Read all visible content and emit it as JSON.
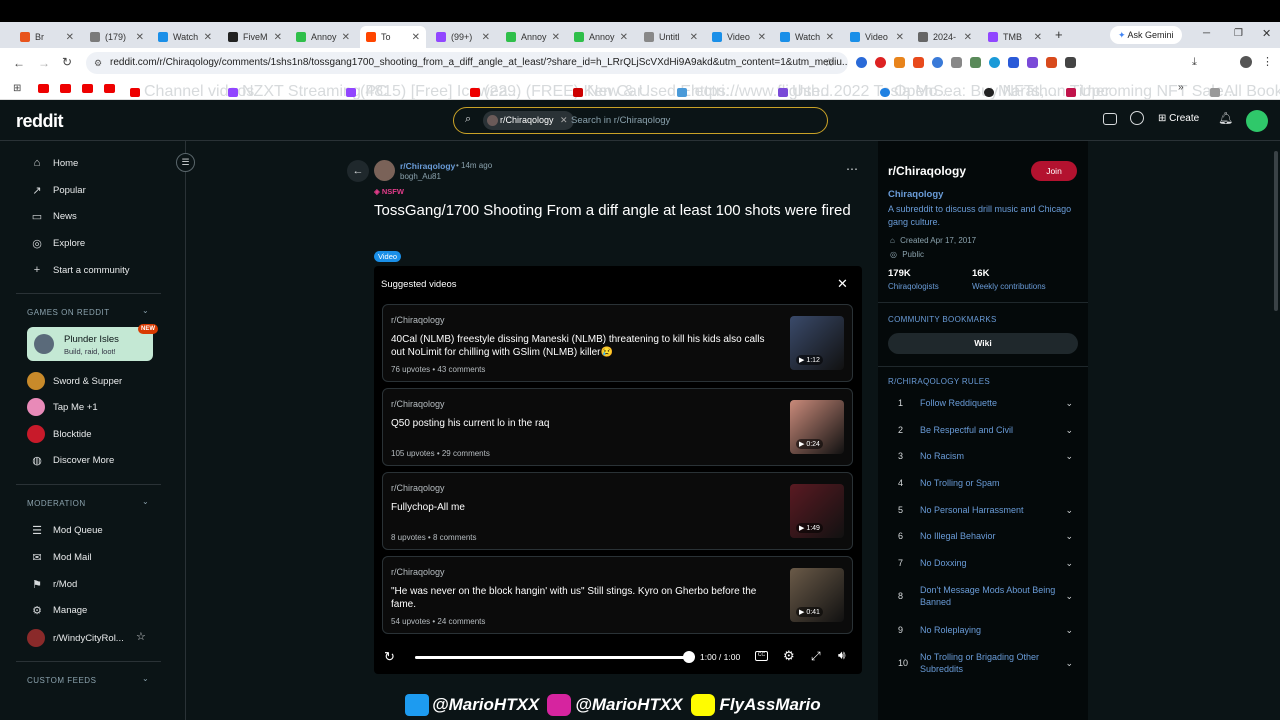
{
  "browser": {
    "tabs": [
      {
        "label": "Br",
        "color": "#e8541c"
      },
      {
        "label": "(179)",
        "color": "#7a7a7a"
      },
      {
        "label": "Watch",
        "color": "#1a8fe8"
      },
      {
        "label": "FiveM",
        "color": "#222222"
      },
      {
        "label": "Annoy",
        "color": "#2fbf4a"
      },
      {
        "label": "To",
        "color": "#ff4500"
      },
      {
        "label": "(99+)",
        "color": "#9146ff"
      },
      {
        "label": "Annoy",
        "color": "#2fbf4a"
      },
      {
        "label": "Annoy",
        "color": "#2fbf4a"
      },
      {
        "label": "Untitl",
        "color": "#888888"
      },
      {
        "label": "Video",
        "color": "#1a8fe8"
      },
      {
        "label": "Watch",
        "color": "#1a8fe8"
      },
      {
        "label": "Video",
        "color": "#1a8fe8"
      },
      {
        "label": "2024-",
        "color": "#666666"
      },
      {
        "label": "TMB",
        "color": "#9146ff"
      }
    ],
    "ask_gemini": "Ask Gemini",
    "url": "reddit.com/r/Chiraqology/comments/1shs1n8/tossgang1700_shooting_from_a_diff_angle_at_least/?share_id=h_LRrQLjScVXdHi9A9akd&utm_content=1&utm_mediu...",
    "bookmarks": [
      "Channel videos",
      "NZXT Streaming PC",
      "(4815) [Free] Icewea...",
      "(229) (FREE) Ken Car...",
      "New & Used Electri...",
      "https://www.flighth...",
      "Used 2022 Tesla Mo...",
      "OpenSea: Buy NFTs,...",
      "Marathon Timer",
      "Upcoming NFT Sale..."
    ],
    "all_bookmarks": "All Bookmarks"
  },
  "header": {
    "logo": "reddit",
    "search_chip": "r/Chiraqology",
    "search_placeholder": "Search in r/Chiraqology",
    "create": "Create"
  },
  "sidebar": {
    "nav": [
      "Home",
      "Popular",
      "News",
      "Explore",
      "Start a community"
    ],
    "games_title": "GAMES ON REDDIT",
    "featured_game": {
      "name": "Plunder Isles",
      "tagline": "Build, raid, loot!",
      "badge": "NEW"
    },
    "games": [
      "Sword & Supper",
      "Tap Me +1",
      "Blocktide",
      "Discover More"
    ],
    "moderation_title": "MODERATION",
    "moderation": [
      "Mod Queue",
      "Mod Mail",
      "r/Mod",
      "Manage",
      "r/WindyCityRol..."
    ],
    "custom_feeds_title": "CUSTOM FEEDS"
  },
  "post": {
    "subreddit": "r/Chiraqology",
    "time": "• 14m ago",
    "author": "bogh_Au81",
    "nsfw": "NSFW",
    "title": "TossGang/1700 Shooting From a diff angle at least 100 shots were fired",
    "flair": "Video"
  },
  "player": {
    "suggested_title": "Suggested videos",
    "time": "1:00 / 1:00",
    "progress": 1.0,
    "suggestions": [
      {
        "sub": "r/Chiraqology",
        "title": "40Cal (NLMB) freestyle dissing Maneski (NLMB) threatening to kill his kids also calls out NoLimit for chilling with GSlim (NLMB) killer😢",
        "meta": "76 upvotes • 43 comments",
        "duration": "1:12",
        "thumb": "#3a4a6a"
      },
      {
        "sub": "r/Chiraqology",
        "title": "Q50 posting his current lo in the raq",
        "meta": "105 upvotes • 29 comments",
        "duration": "0:24",
        "thumb": "#c98a7a"
      },
      {
        "sub": "r/Chiraqology",
        "title": "Fullychop-All me",
        "meta": "8 upvotes • 8 comments",
        "duration": "1:49",
        "thumb": "#5a1a22"
      },
      {
        "sub": "r/Chiraqology",
        "title": "\"He was never on the block hangin' with us\" Still stings. Kyro on Gherbo before the fame.",
        "meta": "54 upvotes • 24 comments",
        "duration": "0:41",
        "thumb": "#6a5a48"
      }
    ]
  },
  "community": {
    "name": "r/Chiraqology",
    "join": "Join",
    "title": "Chiraqology",
    "description": "A subreddit to discuss drill music and Chicago gang culture.",
    "created": "Created Apr 17, 2017",
    "visibility": "Public",
    "members_count": "179K",
    "members_label": "Chiraqologists",
    "weekly_count": "16K",
    "weekly_label": "Weekly contributions",
    "bookmarks_title": "COMMUNITY BOOKMARKS",
    "wiki": "Wiki",
    "rules_title": "R/CHIRAQOLOGY RULES",
    "rules": [
      {
        "n": "1",
        "t": "Follow Reddiquette"
      },
      {
        "n": "2",
        "t": "Be Respectful and Civil"
      },
      {
        "n": "3",
        "t": "No Racism"
      },
      {
        "n": "4",
        "t": "No Trolling or Spam"
      },
      {
        "n": "5",
        "t": "No Personal Harrassment"
      },
      {
        "n": "6",
        "t": "No Illegal Behavior"
      },
      {
        "n": "7",
        "t": "No Doxxing"
      },
      {
        "n": "8",
        "t": "Don't Message Mods About Being Banned"
      },
      {
        "n": "9",
        "t": "No Roleplaying"
      },
      {
        "n": "10",
        "t": "No Trolling or Brigading Other Subreddits"
      }
    ]
  },
  "overlay": {
    "twitter": "@MarioHTXX",
    "instagram": "@MarioHTXX",
    "snapchat": "FlyAssMario"
  }
}
